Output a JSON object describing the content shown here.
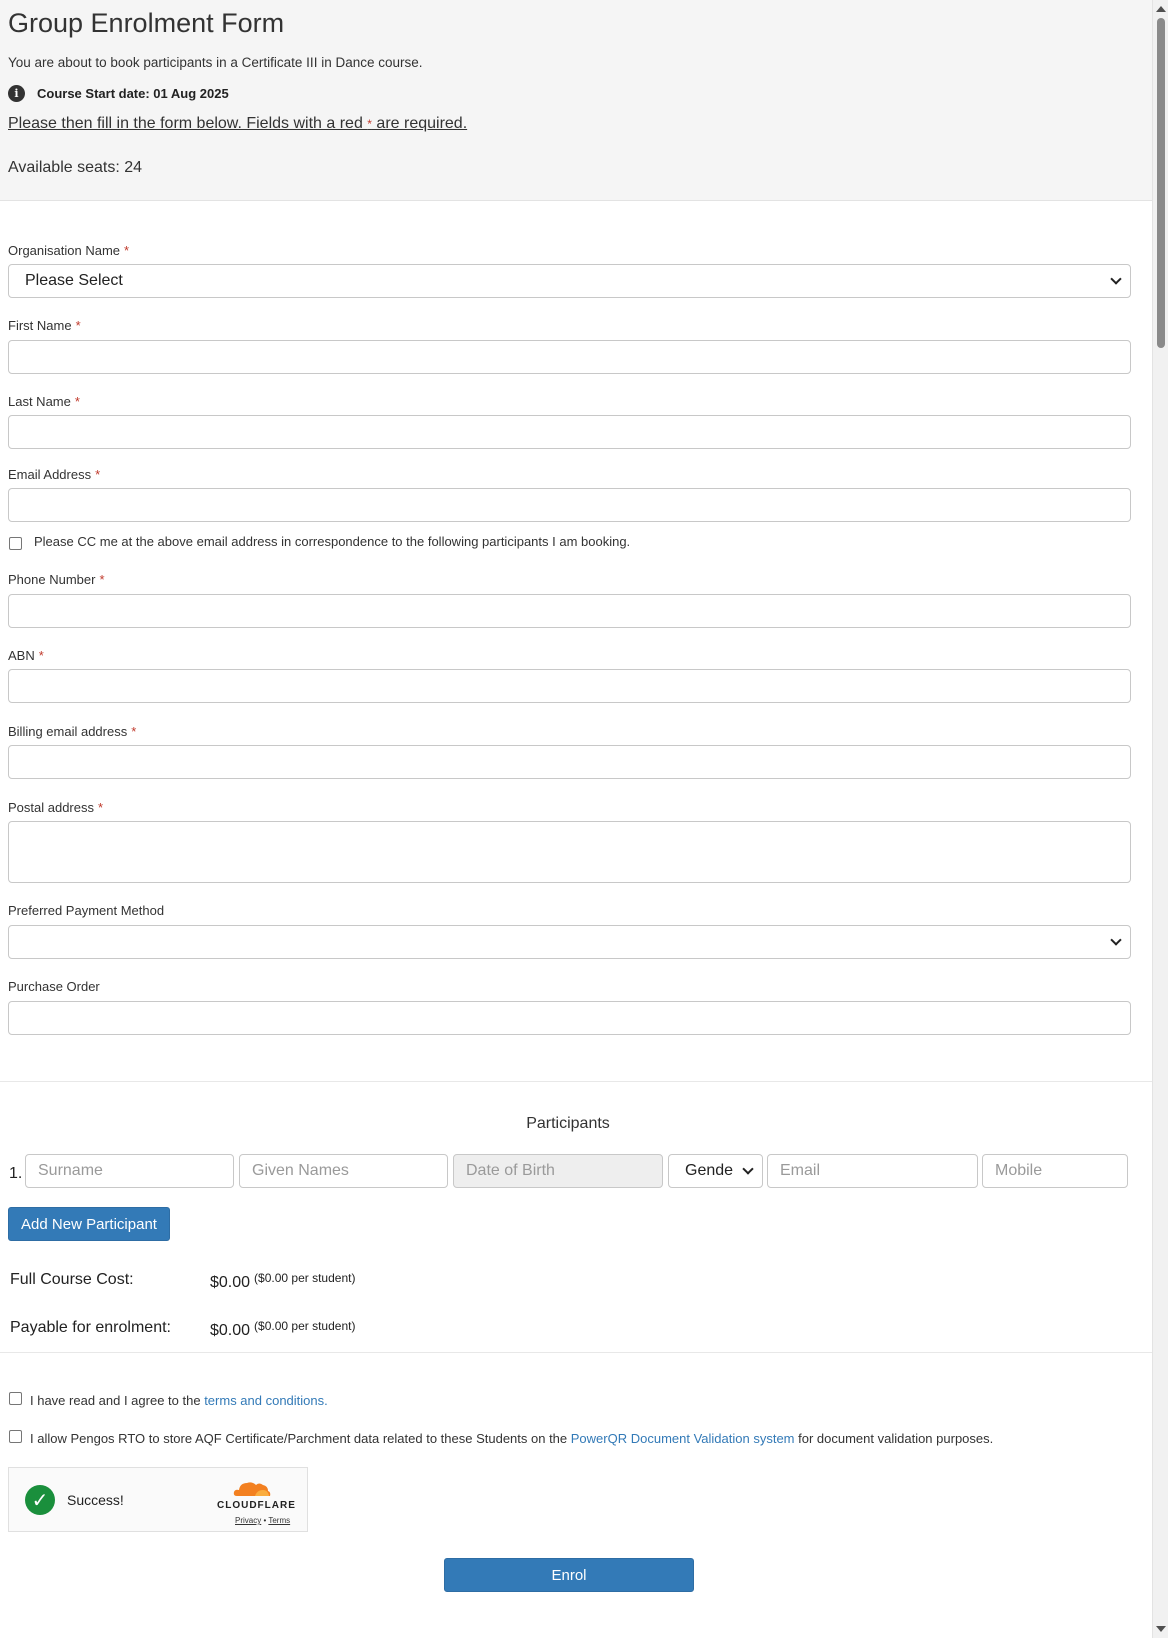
{
  "header": {
    "title": "Group Enrolment Form",
    "intro": "You are about to book participants in a Certificate III in Dance course.",
    "info_icon": "info-icon",
    "start_date": "Course Start date: 01 Aug 2025",
    "instructions_pre": "Please then fill in the form below. Fields with a red ",
    "required_star": "*",
    "instructions_post": " are required.",
    "available_seats": "Available seats: 24"
  },
  "form": {
    "required_star": "*",
    "organisation": {
      "label": "Organisation Name",
      "selected": "Please Select"
    },
    "first_name": {
      "label": "First Name",
      "value": ""
    },
    "last_name": {
      "label": "Last Name",
      "value": ""
    },
    "email": {
      "label": "Email Address",
      "value": ""
    },
    "cc_me": {
      "label": "Please CC me at the above email address in correspondence to the following participants I am booking.",
      "checked": false
    },
    "phone": {
      "label": "Phone Number",
      "value": ""
    },
    "abn": {
      "label": "ABN",
      "value": ""
    },
    "billing_email": {
      "label": "Billing email address",
      "value": ""
    },
    "postal_address": {
      "label": "Postal address",
      "value": ""
    },
    "payment_method": {
      "label": "Preferred Payment Method",
      "selected": ""
    },
    "purchase_order": {
      "label": "Purchase Order",
      "value": ""
    }
  },
  "participants": {
    "title": "Participants",
    "rows": [
      {
        "number": "1.",
        "surname_placeholder": "Surname",
        "given_names_placeholder": "Given Names",
        "dob_placeholder": "Date of Birth",
        "gender_selected": "Gende",
        "email_placeholder": "Email",
        "mobile_placeholder": "Mobile"
      }
    ],
    "add_button": "Add New Participant"
  },
  "costs": {
    "full_label": "Full Course Cost:",
    "full_value": "$0.00",
    "full_per": "($0.00 per student)",
    "payable_label": "Payable for enrolment:",
    "payable_value": "$0.00",
    "payable_per": "($0.00 per student)"
  },
  "agreements": {
    "terms_pre": "I have read and I agree to the ",
    "terms_link": "terms and conditions.",
    "aqf_pre": "I allow Pengos RTO to store AQF Certificate/Parchment data related to these Students on the ",
    "aqf_link": "PowerQR Document Validation system",
    "aqf_post": " for document validation purposes."
  },
  "captcha": {
    "status": "Success!",
    "brand": "CLOUDFLARE",
    "privacy": "Privacy",
    "separator": " • ",
    "terms": "Terms"
  },
  "submit": {
    "label": "Enrol"
  },
  "colors": {
    "primary": "#337ab7",
    "required": "#c0392b",
    "success": "#1a8f3c",
    "cloudflare": "#f38020"
  }
}
